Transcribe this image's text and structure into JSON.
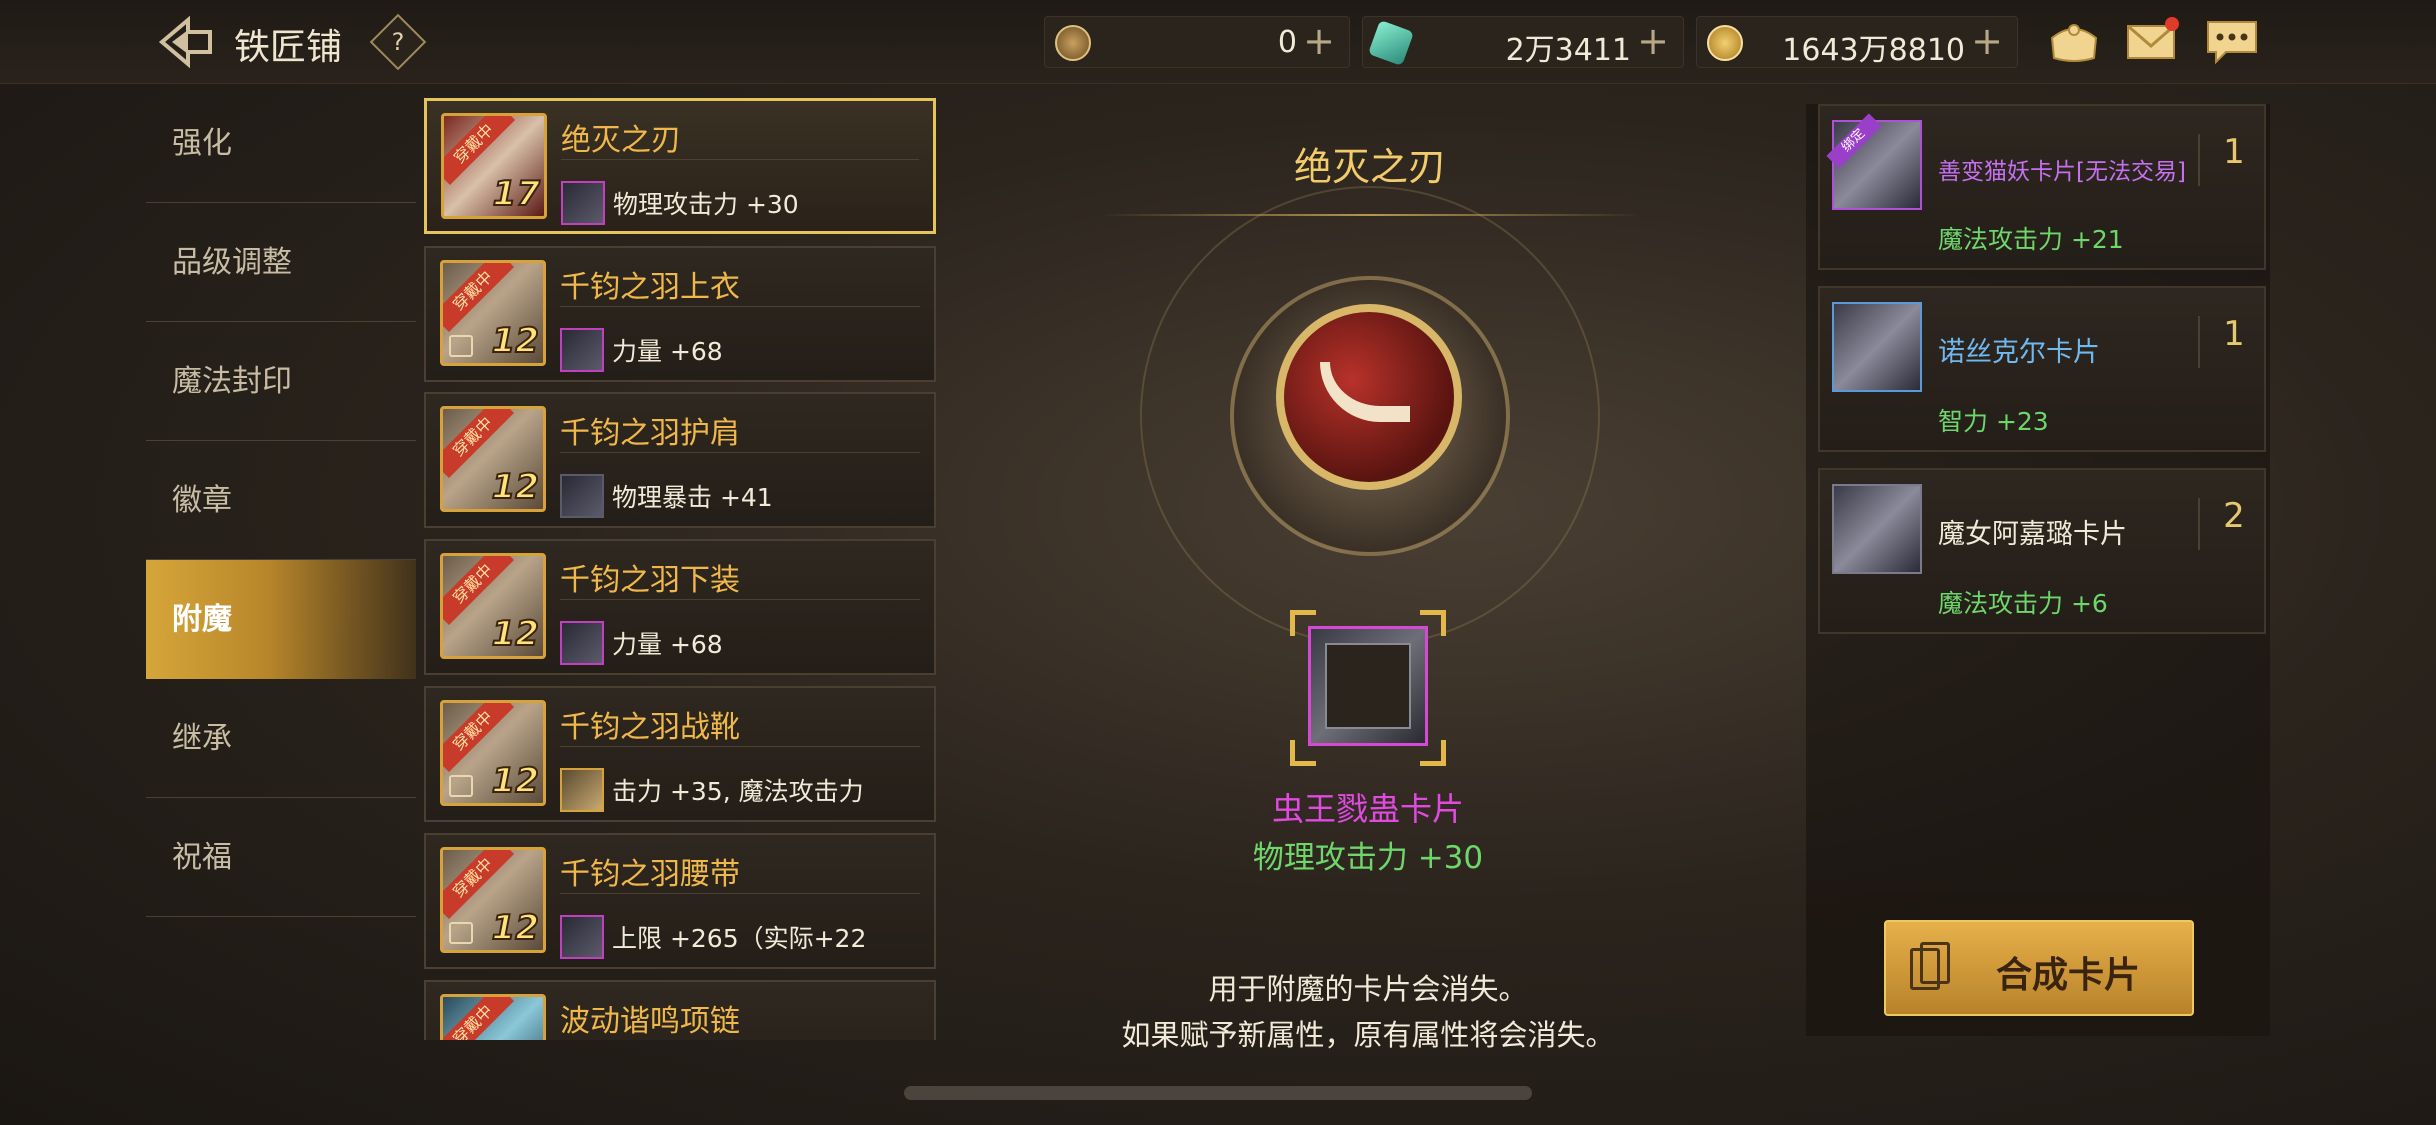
{
  "header": {
    "title": "铁匠铺",
    "help_label": "?",
    "currencies": [
      {
        "icon": "coupon-coin-icon",
        "value": "0"
      },
      {
        "icon": "crystal-icon",
        "value": "2万3411"
      },
      {
        "icon": "gold-coin-icon",
        "value": "1643万8810"
      }
    ],
    "plus_label": "+"
  },
  "menu": {
    "items": [
      {
        "label": "强化"
      },
      {
        "label": "品级调整"
      },
      {
        "label": "魔法封印"
      },
      {
        "label": "徽章"
      },
      {
        "label": "附魔"
      },
      {
        "label": "继承"
      },
      {
        "label": "祝福"
      }
    ],
    "active_index": 4
  },
  "equipment": [
    {
      "name": "绝灭之刃",
      "badge": "穿戴中",
      "level": "17",
      "stat": "物理攻击力 +30"
    },
    {
      "name": "千钧之羽上衣",
      "badge": "穿戴中",
      "level": "12",
      "stat": "力量 +68"
    },
    {
      "name": "千钧之羽护肩",
      "badge": "穿戴中",
      "level": "12",
      "stat": "物理暴击 +41"
    },
    {
      "name": "千钧之羽下装",
      "badge": "穿戴中",
      "level": "12",
      "stat": "力量 +68"
    },
    {
      "name": "千钧之羽战靴",
      "badge": "穿戴中",
      "level": "12",
      "stat": "击力 +35, 魔法攻击力"
    },
    {
      "name": "千钧之羽腰带",
      "badge": "穿戴中",
      "level": "12",
      "stat": "上限 +265（实际+22"
    },
    {
      "name": "波动谐鸣项链",
      "badge": "穿戴中",
      "level": "",
      "stat": ""
    }
  ],
  "center": {
    "item_name": "绝灭之刃",
    "card_name": "虫王戮蛊卡片",
    "card_stat": "物理攻击力 +30",
    "notice_line1": "用于附魔的卡片会消失。",
    "notice_line2": "如果赋予新属性，原有属性将会消失。"
  },
  "cards": [
    {
      "name": "善变猫妖卡片[无法交易]",
      "tag": "绑定",
      "count": "1",
      "stat": "魔法攻击力 +21",
      "color": "#c470f0"
    },
    {
      "name": "诺丝克尔卡片",
      "count": "1",
      "stat": "智力 +23",
      "color": "#70b8f0"
    },
    {
      "name": "魔女阿嘉璐卡片",
      "count": "2",
      "stat": "魔法攻击力 +6",
      "color": "#f2ead8"
    }
  ],
  "craft_button": {
    "label": "合成卡片"
  },
  "colors": {
    "accent_gold": "#e6b04a",
    "stat_green": "#6ed66a",
    "card_purple": "#e04ae0"
  }
}
